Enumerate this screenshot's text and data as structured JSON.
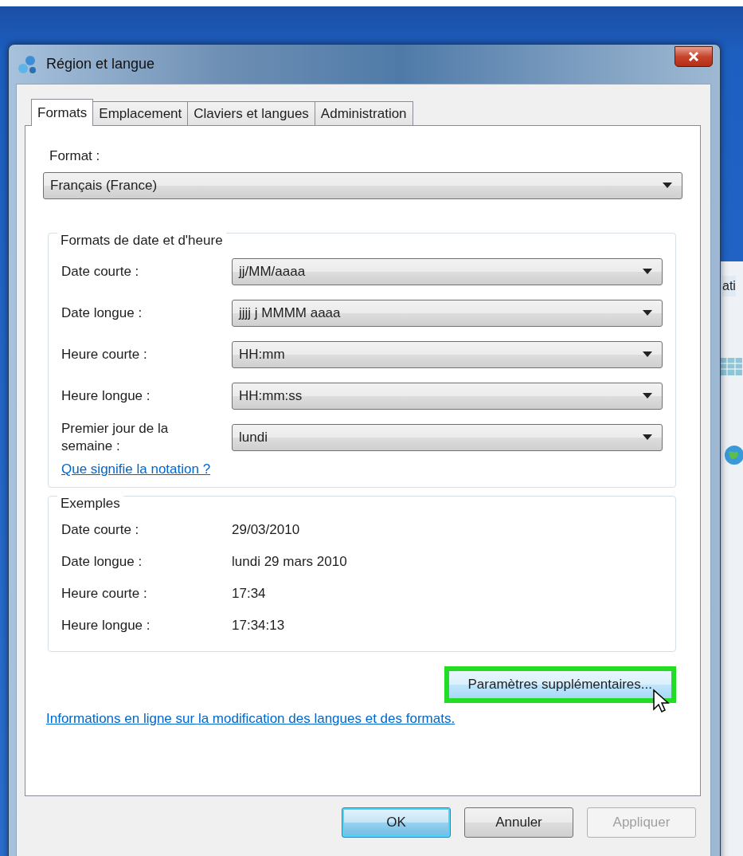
{
  "window": {
    "title": "Région et langue"
  },
  "tabs": [
    {
      "label": "Formats",
      "selected": true
    },
    {
      "label": "Emplacement",
      "selected": false
    },
    {
      "label": "Claviers et langues",
      "selected": false
    },
    {
      "label": "Administration",
      "selected": false
    }
  ],
  "format": {
    "label": "Format :",
    "value": "Français (France)"
  },
  "date_time_formats": {
    "title": "Formats de date et d'heure",
    "rows": [
      {
        "label": "Date courte :",
        "value": "jj/MM/aaaa"
      },
      {
        "label": "Date longue :",
        "value": "jjjj j MMMM aaaa"
      },
      {
        "label": "Heure courte :",
        "value": "HH:mm"
      },
      {
        "label": "Heure longue :",
        "value": "HH:mm:ss"
      },
      {
        "label": "Premier jour de la semaine :",
        "value": "lundi"
      }
    ],
    "link": "Que signifie la notation ?"
  },
  "examples": {
    "title": "Exemples",
    "rows": [
      {
        "label": "Date courte :",
        "value": "29/03/2010"
      },
      {
        "label": "Date longue :",
        "value": "lundi 29 mars 2010"
      },
      {
        "label": "Heure courte :",
        "value": "17:34"
      },
      {
        "label": "Heure longue :",
        "value": "17:34:13"
      }
    ]
  },
  "additional_settings_button": {
    "label": "Paramètres supplémentaires...",
    "highlighted": true
  },
  "online_link": "Informations en ligne sur la modification des langues et des formats.",
  "buttons": [
    {
      "label": "OK",
      "default": true,
      "disabled": false
    },
    {
      "label": "Annuler",
      "default": false,
      "disabled": false
    },
    {
      "label": "Appliquer",
      "default": false,
      "disabled": true
    }
  ],
  "background_window": {
    "text": "ati"
  }
}
